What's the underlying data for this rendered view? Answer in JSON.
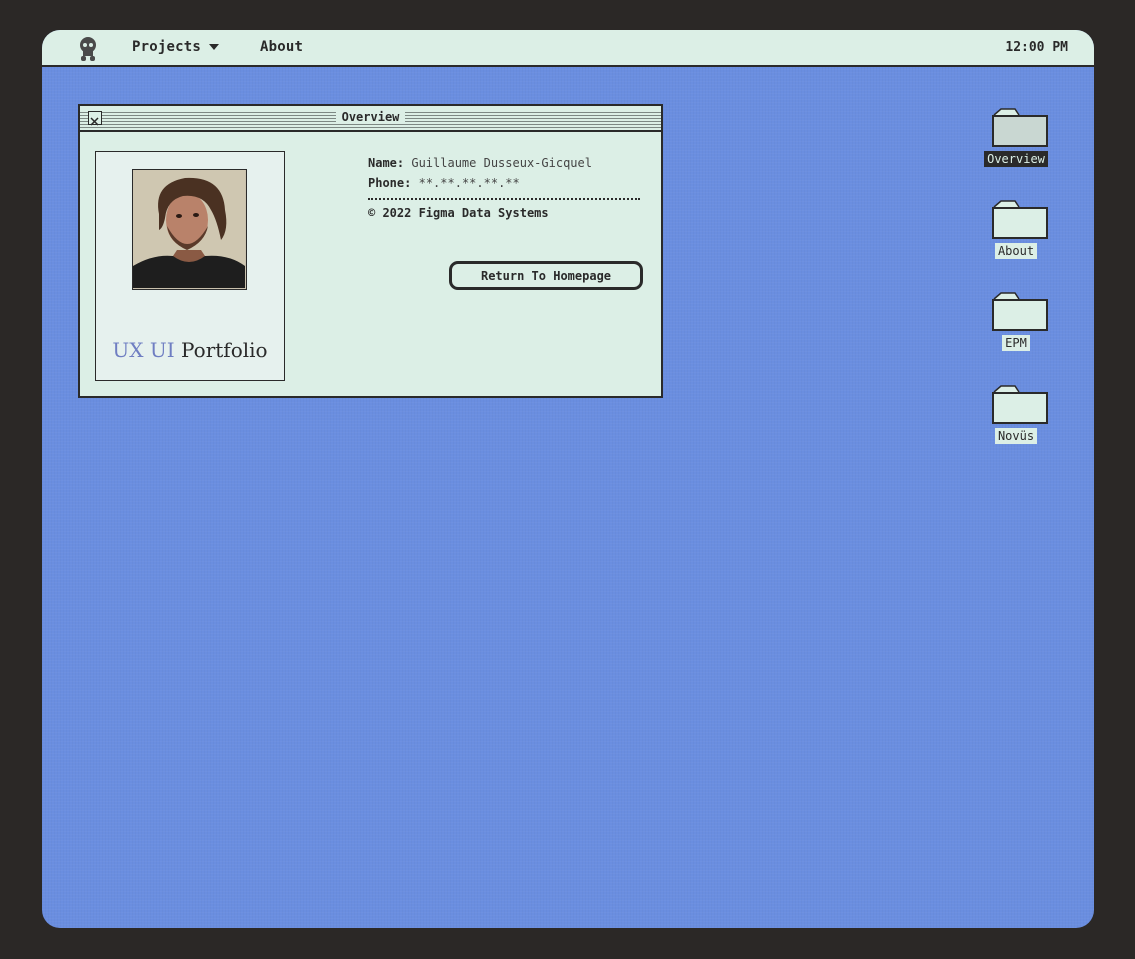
{
  "menubar": {
    "logo_icon": "skull-icon",
    "projects_label": "Projects",
    "about_label": "About",
    "clock": "12:00 PM"
  },
  "window": {
    "title": "Overview",
    "close_icon": "close-box-icon",
    "portfolio_ux": "UX UI",
    "portfolio_word": "Portfolio",
    "name_key": "Name:",
    "name_value": "Guillaume Dusseux-Gicquel",
    "phone_key": "Phone:",
    "phone_value": "**.**.**.**.**",
    "copyright": "© 2022 Figma Data Systems",
    "button_label": "Return To Homepage"
  },
  "desktop_icons": [
    {
      "label": "Overview",
      "icon": "folder-icon",
      "selected": true
    },
    {
      "label": "About",
      "icon": "folder-icon",
      "selected": false
    },
    {
      "label": "EPM",
      "icon": "folder-icon",
      "selected": false
    },
    {
      "label": "Novüs",
      "icon": "folder-icon",
      "selected": false
    }
  ],
  "colors": {
    "desktop": "#6a8ee0",
    "panel": "#dcefe6",
    "ink": "#2a2a2a",
    "accent_text": "#6f7ec2"
  }
}
